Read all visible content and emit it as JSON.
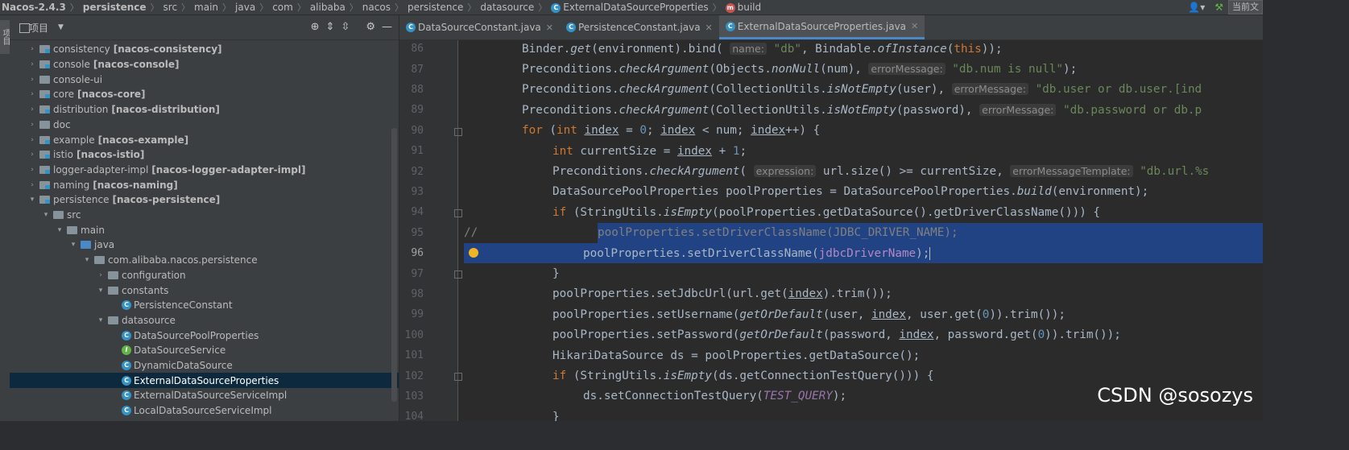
{
  "breadcrumb": {
    "items": [
      "Nacos-2.4.3",
      "persistence",
      "src",
      "main",
      "java",
      "com",
      "alibaba",
      "nacos",
      "persistence",
      "datasource",
      "ExternalDataSourceProperties",
      "build"
    ],
    "right_label": "当前文"
  },
  "left_stripe": {
    "label": "项目"
  },
  "project_panel": {
    "title": "项目",
    "tree": [
      {
        "indent": 0,
        "arrow": "›",
        "name": "consistency",
        "module": "[nacos-consistency]",
        "icon": "mod"
      },
      {
        "indent": 0,
        "arrow": "›",
        "name": "console",
        "module": "[nacos-console]",
        "icon": "mod"
      },
      {
        "indent": 0,
        "arrow": "›",
        "name": "console-ui",
        "module": "",
        "icon": "plain"
      },
      {
        "indent": 0,
        "arrow": "›",
        "name": "core",
        "module": "[nacos-core]",
        "icon": "mod"
      },
      {
        "indent": 0,
        "arrow": "›",
        "name": "distribution",
        "module": "[nacos-distribution]",
        "icon": "mod"
      },
      {
        "indent": 0,
        "arrow": "›",
        "name": "doc",
        "module": "",
        "icon": "plain"
      },
      {
        "indent": 0,
        "arrow": "›",
        "name": "example",
        "module": "[nacos-example]",
        "icon": "mod"
      },
      {
        "indent": 0,
        "arrow": "›",
        "name": "istio",
        "module": "[nacos-istio]",
        "icon": "mod"
      },
      {
        "indent": 0,
        "arrow": "›",
        "name": "logger-adapter-impl",
        "module": "[nacos-logger-adapter-impl]",
        "icon": "mod"
      },
      {
        "indent": 0,
        "arrow": "›",
        "name": "naming",
        "module": "[nacos-naming]",
        "icon": "mod"
      },
      {
        "indent": 0,
        "arrow": "⌄",
        "name": "persistence",
        "module": "[nacos-persistence]",
        "icon": "mod"
      },
      {
        "indent": 1,
        "arrow": "⌄",
        "name": "src",
        "module": "",
        "icon": "plain"
      },
      {
        "indent": 2,
        "arrow": "⌄",
        "name": "main",
        "module": "",
        "icon": "plain"
      },
      {
        "indent": 3,
        "arrow": "⌄",
        "name": "java",
        "module": "",
        "icon": "src"
      },
      {
        "indent": 4,
        "arrow": "⌄",
        "name": "com.alibaba.nacos.persistence",
        "module": "",
        "icon": "pkg"
      },
      {
        "indent": 5,
        "arrow": "›",
        "name": "configuration",
        "module": "",
        "icon": "pkg"
      },
      {
        "indent": 5,
        "arrow": "⌄",
        "name": "constants",
        "module": "",
        "icon": "pkg"
      },
      {
        "indent": 6,
        "arrow": "",
        "name": "PersistenceConstant",
        "module": "",
        "icon": "class-c"
      },
      {
        "indent": 5,
        "arrow": "⌄",
        "name": "datasource",
        "module": "",
        "icon": "pkg"
      },
      {
        "indent": 6,
        "arrow": "",
        "name": "DataSourcePoolProperties",
        "module": "",
        "icon": "class-c"
      },
      {
        "indent": 6,
        "arrow": "",
        "name": "DataSourceService",
        "module": "",
        "icon": "class-i"
      },
      {
        "indent": 6,
        "arrow": "",
        "name": "DynamicDataSource",
        "module": "",
        "icon": "class-c"
      },
      {
        "indent": 6,
        "arrow": "",
        "name": "ExternalDataSourceProperties",
        "module": "",
        "icon": "class-c",
        "selected": true
      },
      {
        "indent": 6,
        "arrow": "",
        "name": "ExternalDataSourceServiceImpl",
        "module": "",
        "icon": "class-c"
      },
      {
        "indent": 6,
        "arrow": "",
        "name": "LocalDataSourceServiceImpl",
        "module": "",
        "icon": "class-c"
      }
    ]
  },
  "tabs": [
    {
      "label": "DataSourceConstant.java",
      "active": false
    },
    {
      "label": "PersistenceConstant.java",
      "active": false
    },
    {
      "label": "ExternalDataSourceProperties.java",
      "active": true
    }
  ],
  "editor": {
    "line_numbers": [
      "86",
      "87",
      "88",
      "89",
      "90",
      "91",
      "92",
      "93",
      "94",
      "95",
      "96",
      "97",
      "98",
      "99",
      "100",
      "101",
      "102",
      "103",
      "104"
    ],
    "comment_marker": "//",
    "highlighted_lines": [
      "95",
      "96"
    ]
  },
  "watermark": "CSDN @sosozys",
  "colors": {
    "keyword": "#cc7832",
    "string": "#6a8759",
    "number": "#6897bb",
    "selection": "#214283",
    "bulb": "#f0b427"
  }
}
